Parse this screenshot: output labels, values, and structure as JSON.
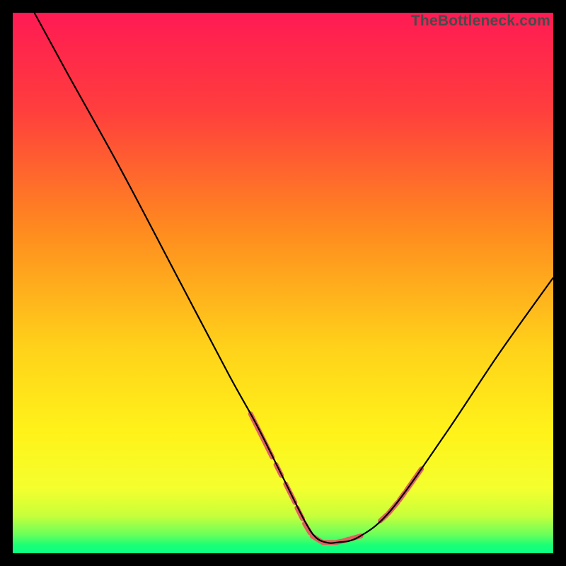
{
  "watermark": "TheBottleneck.com",
  "chart_data": {
    "type": "line",
    "title": "",
    "xlabel": "",
    "ylabel": "",
    "xlim": [
      0,
      100
    ],
    "ylim": [
      0,
      100
    ],
    "series": [
      {
        "name": "curve",
        "x": [
          4,
          10,
          20,
          30,
          40,
          45,
          50,
          54,
          56,
          58,
          60,
          64,
          70,
          80,
          90,
          100
        ],
        "y": [
          100,
          89,
          71,
          52,
          33,
          24,
          14,
          6,
          3,
          2,
          2,
          3,
          8,
          22,
          37,
          51
        ]
      }
    ],
    "highlighted_segments": [
      {
        "x0": 44.0,
        "y0": 25.8,
        "x1": 48.0,
        "y1": 17.8
      },
      {
        "x0": 48.7,
        "y0": 16.4,
        "x1": 49.7,
        "y1": 14.4
      },
      {
        "x0": 50.5,
        "y0": 12.8,
        "x1": 52.2,
        "y1": 9.4
      },
      {
        "x0": 52.6,
        "y0": 8.4,
        "x1": 53.6,
        "y1": 6.4
      },
      {
        "x0": 54.0,
        "y0": 5.5,
        "x1": 55.0,
        "y1": 3.8
      },
      {
        "x0": 55.4,
        "y0": 3.2,
        "x1": 57.0,
        "y1": 2.2
      },
      {
        "x0": 57.4,
        "y0": 2.0,
        "x1": 59.4,
        "y1": 2.0
      },
      {
        "x0": 59.8,
        "y0": 2.0,
        "x1": 60.8,
        "y1": 2.2
      },
      {
        "x0": 61.2,
        "y0": 2.3,
        "x1": 62.2,
        "y1": 2.6
      },
      {
        "x0": 62.6,
        "y0": 2.7,
        "x1": 64.4,
        "y1": 3.2
      },
      {
        "x0": 68.0,
        "y0": 6.0,
        "x1": 69.2,
        "y1": 7.1
      },
      {
        "x0": 69.5,
        "y0": 7.4,
        "x1": 71.2,
        "y1": 9.4
      },
      {
        "x0": 71.5,
        "y0": 9.8,
        "x1": 72.5,
        "y1": 11.2
      },
      {
        "x0": 72.8,
        "y0": 11.6,
        "x1": 75.6,
        "y1": 15.6
      }
    ],
    "gradient_stops": [
      {
        "offset": 0.0,
        "color": "#ff1a54"
      },
      {
        "offset": 0.18,
        "color": "#ff3e3d"
      },
      {
        "offset": 0.4,
        "color": "#ff8a1f"
      },
      {
        "offset": 0.62,
        "color": "#ffd21a"
      },
      {
        "offset": 0.78,
        "color": "#fff31a"
      },
      {
        "offset": 0.88,
        "color": "#f4ff2e"
      },
      {
        "offset": 0.93,
        "color": "#c8ff3a"
      },
      {
        "offset": 0.965,
        "color": "#6bff5a"
      },
      {
        "offset": 0.985,
        "color": "#1aff76"
      },
      {
        "offset": 1.0,
        "color": "#0aff84"
      }
    ],
    "colors": {
      "curve": "#000000",
      "segment": "#e0615f",
      "background": "#000000"
    }
  }
}
